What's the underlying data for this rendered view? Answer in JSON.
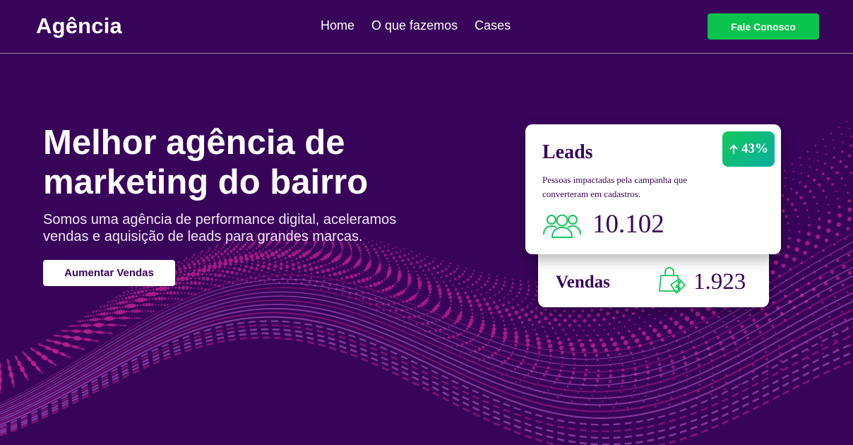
{
  "header": {
    "logo": "Agência",
    "nav": [
      "Home",
      "O que fazemos",
      "Cases"
    ],
    "cta_label": "Fale Conosco"
  },
  "hero": {
    "title_line1": "Melhor agência de",
    "title_line2": "marketing do bairro",
    "subtitle_line1": "Somos uma agência de performance digital, aceleramos",
    "subtitle_line2": "vendas e aquisição de leads para grandes marcas.",
    "button_label": "Aumentar Vendas"
  },
  "stats": {
    "leads": {
      "title": "Leads",
      "badge": "43%",
      "badge_icon": "arrow-up-icon",
      "description_line1": "Pessoas impactadas pela campanha que",
      "description_line2": "converteram em cadastros.",
      "icon": "users-icon",
      "value": "10.102"
    },
    "vendas": {
      "title": "Vendas",
      "icon": "shopping-bag-icon",
      "value": "1.923"
    }
  },
  "colors": {
    "background": "#38045a",
    "accent_green": "#0ac44d",
    "wave_magenta": "#b8208f",
    "wave_violet": "#c060d6"
  }
}
